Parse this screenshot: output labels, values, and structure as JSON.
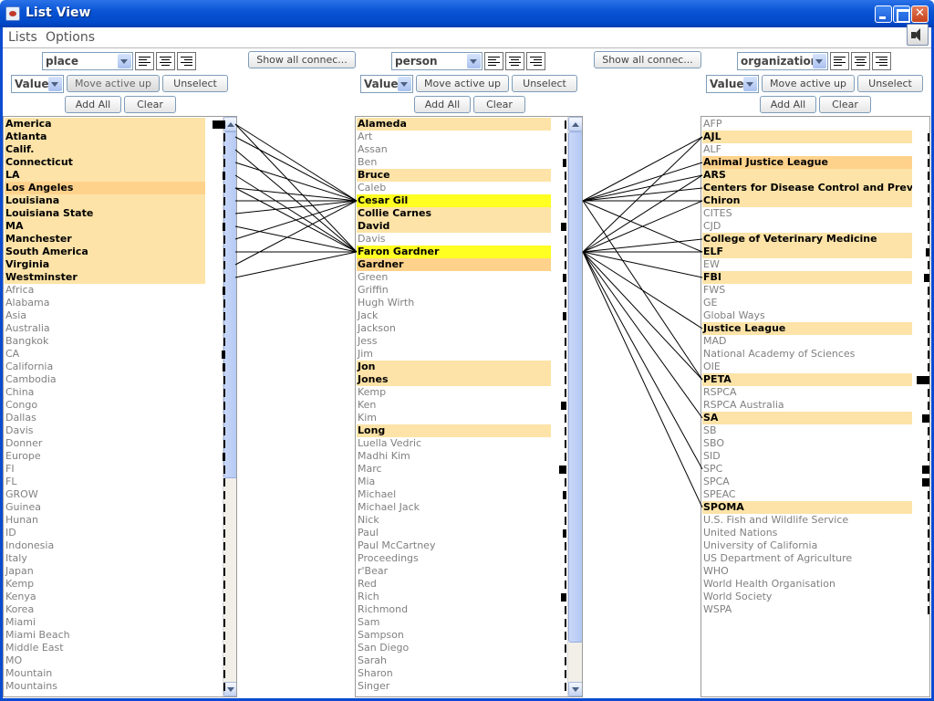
{
  "window": {
    "title": "List View"
  },
  "menu": {
    "lists": "Lists",
    "options": "Options"
  },
  "colors": {
    "selected": "#fde3a7",
    "selected_strong": "#ffd28c",
    "highlight": "#ffff22",
    "muted_text": "#808080",
    "line": "#000000"
  },
  "show_all_label": "Show all connec...",
  "panels": [
    {
      "type": "place",
      "sort_mode": "Value",
      "move_up_label": "Move active up",
      "unselect_label": "Unselect",
      "add_all_label": "Add All",
      "clear_label": "Clear",
      "items": [
        {
          "label": "America",
          "state": "selected",
          "count": 14
        },
        {
          "label": "Atlanta",
          "state": "selected",
          "count": 1
        },
        {
          "label": "Calif.",
          "state": "selected",
          "count": 1
        },
        {
          "label": "Connecticut",
          "state": "selected",
          "count": 1
        },
        {
          "label": "LA",
          "state": "selected",
          "count": 3
        },
        {
          "label": "Los Angeles",
          "state": "selected-strong",
          "count": 2
        },
        {
          "label": "Louisiana",
          "state": "selected",
          "count": 1
        },
        {
          "label": "Louisiana State",
          "state": "selected",
          "count": 1
        },
        {
          "label": "MA",
          "state": "selected",
          "count": 3
        },
        {
          "label": "Manchester",
          "state": "selected",
          "count": 1
        },
        {
          "label": "South America",
          "state": "selected",
          "count": 1
        },
        {
          "label": "Virginia",
          "state": "selected",
          "count": 2
        },
        {
          "label": "Westminster",
          "state": "selected",
          "count": 1
        },
        {
          "label": "Africa",
          "state": "none",
          "count": 3
        },
        {
          "label": "Alabama",
          "state": "none",
          "count": 1
        },
        {
          "label": "Asia",
          "state": "none",
          "count": 2
        },
        {
          "label": "Australia",
          "state": "none",
          "count": 2
        },
        {
          "label": "Bangkok",
          "state": "none",
          "count": 1
        },
        {
          "label": "CA",
          "state": "none",
          "count": 4
        },
        {
          "label": "California",
          "state": "none",
          "count": 3
        },
        {
          "label": "Cambodia",
          "state": "none",
          "count": 1
        },
        {
          "label": "China",
          "state": "none",
          "count": 1
        },
        {
          "label": "Congo",
          "state": "none",
          "count": 1
        },
        {
          "label": "Dallas",
          "state": "none",
          "count": 1
        },
        {
          "label": "Davis",
          "state": "none",
          "count": 1
        },
        {
          "label": "Donner",
          "state": "none",
          "count": 1
        },
        {
          "label": "Europe",
          "state": "none",
          "count": 3
        },
        {
          "label": "FI",
          "state": "none",
          "count": 1
        },
        {
          "label": "FL",
          "state": "none",
          "count": 1
        },
        {
          "label": "GROW",
          "state": "none",
          "count": 1
        },
        {
          "label": "Guinea",
          "state": "none",
          "count": 1
        },
        {
          "label": "Hunan",
          "state": "none",
          "count": 1
        },
        {
          "label": "ID",
          "state": "none",
          "count": 2
        },
        {
          "label": "Indonesia",
          "state": "none",
          "count": 1
        },
        {
          "label": "Italy",
          "state": "none",
          "count": 1
        },
        {
          "label": "Japan",
          "state": "none",
          "count": 2
        },
        {
          "label": "Kemp",
          "state": "none",
          "count": 1
        },
        {
          "label": "Kenya",
          "state": "none",
          "count": 1
        },
        {
          "label": "Korea",
          "state": "none",
          "count": 1
        },
        {
          "label": "Miami",
          "state": "none",
          "count": 1
        },
        {
          "label": "Miami Beach",
          "state": "none",
          "count": 1
        },
        {
          "label": "Middle East",
          "state": "none",
          "count": 1
        },
        {
          "label": "MO",
          "state": "none",
          "count": 1
        },
        {
          "label": "Mountain",
          "state": "none",
          "count": 2
        },
        {
          "label": "Mountains",
          "state": "none",
          "count": 1
        }
      ]
    },
    {
      "type": "person",
      "sort_mode": "Value",
      "move_up_label": "Move active up",
      "unselect_label": "Unselect",
      "add_all_label": "Add All",
      "clear_label": "Clear",
      "items": [
        {
          "label": "Alameda",
          "state": "selected",
          "count": 1
        },
        {
          "label": "Art",
          "state": "none",
          "count": 1
        },
        {
          "label": "Assan",
          "state": "none",
          "count": 1
        },
        {
          "label": "Ben",
          "state": "none",
          "count": 2
        },
        {
          "label": "Bruce",
          "state": "selected",
          "count": 1
        },
        {
          "label": "Caleb",
          "state": "none",
          "count": 1
        },
        {
          "label": "Cesar Gil",
          "state": "highlight",
          "count": 1
        },
        {
          "label": "Collie Carnes",
          "state": "selected",
          "count": 1
        },
        {
          "label": "David",
          "state": "selected",
          "count": 3
        },
        {
          "label": "Davis",
          "state": "none",
          "count": 1
        },
        {
          "label": "Faron Gardner",
          "state": "highlight",
          "count": 1
        },
        {
          "label": "Gardner",
          "state": "selected-strong",
          "count": 1
        },
        {
          "label": "Green",
          "state": "none",
          "count": 2
        },
        {
          "label": "Griffin",
          "state": "none",
          "count": 1
        },
        {
          "label": "Hugh Wirth",
          "state": "none",
          "count": 1
        },
        {
          "label": "Jack",
          "state": "none",
          "count": 2
        },
        {
          "label": "Jackson",
          "state": "none",
          "count": 1
        },
        {
          "label": "Jess",
          "state": "none",
          "count": 1
        },
        {
          "label": "Jim",
          "state": "none",
          "count": 1
        },
        {
          "label": "Jon",
          "state": "selected",
          "count": 1
        },
        {
          "label": "Jones",
          "state": "selected",
          "count": 1
        },
        {
          "label": "Kemp",
          "state": "none",
          "count": 1
        },
        {
          "label": "Ken",
          "state": "none",
          "count": 3
        },
        {
          "label": "Kim",
          "state": "none",
          "count": 1
        },
        {
          "label": "Long",
          "state": "selected",
          "count": 1
        },
        {
          "label": "Luella Vedric",
          "state": "none",
          "count": 1
        },
        {
          "label": "Madhi Kim",
          "state": "none",
          "count": 1
        },
        {
          "label": "Marc",
          "state": "none",
          "count": 4
        },
        {
          "label": "Mia",
          "state": "none",
          "count": 1
        },
        {
          "label": "Michael",
          "state": "none",
          "count": 2
        },
        {
          "label": "Michael Jack",
          "state": "none",
          "count": 1
        },
        {
          "label": "Nick",
          "state": "none",
          "count": 1
        },
        {
          "label": "Paul",
          "state": "none",
          "count": 2
        },
        {
          "label": "Paul McCartney",
          "state": "none",
          "count": 1
        },
        {
          "label": "Proceedings",
          "state": "none",
          "count": 1
        },
        {
          "label": "r'Bear",
          "state": "none",
          "count": 1
        },
        {
          "label": "Red",
          "state": "none",
          "count": 1
        },
        {
          "label": "Rich",
          "state": "none",
          "count": 3
        },
        {
          "label": "Richmond",
          "state": "none",
          "count": 1
        },
        {
          "label": "Sam",
          "state": "none",
          "count": 1
        },
        {
          "label": "Sampson",
          "state": "none",
          "count": 1
        },
        {
          "label": "San Diego",
          "state": "none",
          "count": 1
        },
        {
          "label": "Sarah",
          "state": "none",
          "count": 1
        },
        {
          "label": "Sharon",
          "state": "none",
          "count": 1
        },
        {
          "label": "Singer",
          "state": "none",
          "count": 1
        }
      ]
    },
    {
      "type": "organization",
      "sort_mode": "Value",
      "move_up_label": "Move active up",
      "unselect_label": "Unselect",
      "add_all_label": "Add All",
      "clear_label": "Clear",
      "items": [
        {
          "label": "AFP",
          "state": "none",
          "count": 0
        },
        {
          "label": "AJL",
          "state": "selected",
          "count": 1
        },
        {
          "label": "ALF",
          "state": "none",
          "count": 1
        },
        {
          "label": "Animal Justice League",
          "state": "selected-strong",
          "count": 1
        },
        {
          "label": "ARS",
          "state": "selected",
          "count": 1
        },
        {
          "label": "Centers for Disease Control and Preventi",
          "state": "selected",
          "count": 1
        },
        {
          "label": "Chiron",
          "state": "selected",
          "count": 1
        },
        {
          "label": "CITES",
          "state": "none",
          "count": 1
        },
        {
          "label": "CJD",
          "state": "none",
          "count": 1
        },
        {
          "label": "College of Veterinary Medicine",
          "state": "selected",
          "count": 1
        },
        {
          "label": "ELF",
          "state": "selected",
          "count": 2
        },
        {
          "label": "EW",
          "state": "none",
          "count": 1
        },
        {
          "label": "FBI",
          "state": "selected",
          "count": 3
        },
        {
          "label": "FWS",
          "state": "none",
          "count": 1
        },
        {
          "label": "GE",
          "state": "none",
          "count": 1
        },
        {
          "label": "Global Ways",
          "state": "none",
          "count": 1
        },
        {
          "label": "Justice League",
          "state": "selected",
          "count": 1
        },
        {
          "label": "MAD",
          "state": "none",
          "count": 1
        },
        {
          "label": "National Academy of Sciences",
          "state": "none",
          "count": 1
        },
        {
          "label": "OIE",
          "state": "none",
          "count": 1
        },
        {
          "label": "PETA",
          "state": "selected",
          "count": 7
        },
        {
          "label": "RSPCA",
          "state": "none",
          "count": 1
        },
        {
          "label": "RSPCA Australia",
          "state": "none",
          "count": 1
        },
        {
          "label": "SA",
          "state": "selected",
          "count": 4
        },
        {
          "label": "SB",
          "state": "none",
          "count": 1
        },
        {
          "label": "SBO",
          "state": "none",
          "count": 1
        },
        {
          "label": "SID",
          "state": "none",
          "count": 1
        },
        {
          "label": "SPC",
          "state": "none",
          "count": 4
        },
        {
          "label": "SPCA",
          "state": "none",
          "count": 4
        },
        {
          "label": "SPEAC",
          "state": "none",
          "count": 1
        },
        {
          "label": "SPOMA",
          "state": "selected",
          "count": 1
        },
        {
          "label": "U.S. Fish and Wildlife Service",
          "state": "none",
          "count": 1
        },
        {
          "label": "United Nations",
          "state": "none",
          "count": 1
        },
        {
          "label": "University of California",
          "state": "none",
          "count": 1
        },
        {
          "label": "US Department of Agriculture",
          "state": "none",
          "count": 1
        },
        {
          "label": "WHO",
          "state": "none",
          "count": 1
        },
        {
          "label": "World Health Organisation",
          "state": "none",
          "count": 1
        },
        {
          "label": "World Society",
          "state": "none",
          "count": 1
        },
        {
          "label": "WSPA",
          "state": "none",
          "count": 1
        }
      ]
    }
  ],
  "connections": [
    {
      "from": "place.America",
      "to": "person.Cesar Gil"
    },
    {
      "from": "place.America",
      "to": "person.Faron Gardner"
    },
    {
      "from": "place.Atlanta",
      "to": "person.Cesar Gil"
    },
    {
      "from": "place.Calif.",
      "to": "person.Faron Gardner"
    },
    {
      "from": "place.Connecticut",
      "to": "person.Cesar Gil"
    },
    {
      "from": "place.LA",
      "to": "person.Faron Gardner"
    },
    {
      "from": "place.Los Angeles",
      "to": "person.Cesar Gil"
    },
    {
      "from": "place.Los Angeles",
      "to": "person.Faron Gardner"
    },
    {
      "from": "place.Louisiana",
      "to": "person.Cesar Gil"
    },
    {
      "from": "place.Louisiana State",
      "to": "person.Cesar Gil"
    },
    {
      "from": "place.MA",
      "to": "person.Faron Gardner"
    },
    {
      "from": "place.Manchester",
      "to": "person.Cesar Gil"
    },
    {
      "from": "place.South America",
      "to": "person.Faron Gardner"
    },
    {
      "from": "place.Virginia",
      "to": "person.Cesar Gil"
    },
    {
      "from": "place.Westminster",
      "to": "person.Faron Gardner"
    },
    {
      "from": "person.Cesar Gil",
      "to": "organization.AJL"
    },
    {
      "from": "person.Cesar Gil",
      "to": "organization.Animal Justice League"
    },
    {
      "from": "person.Cesar Gil",
      "to": "organization.ARS"
    },
    {
      "from": "person.Cesar Gil",
      "to": "organization.Centers for Disease Control and Preventi"
    },
    {
      "from": "person.Cesar Gil",
      "to": "organization.Chiron"
    },
    {
      "from": "person.Cesar Gil",
      "to": "organization.ELF"
    },
    {
      "from": "person.Cesar Gil",
      "to": "organization.PETA"
    },
    {
      "from": "person.Faron Gardner",
      "to": "organization.AJL"
    },
    {
      "from": "person.Faron Gardner",
      "to": "organization.ARS"
    },
    {
      "from": "person.Faron Gardner",
      "to": "organization.Chiron"
    },
    {
      "from": "person.Faron Gardner",
      "to": "organization.College of Veterinary Medicine"
    },
    {
      "from": "person.Faron Gardner",
      "to": "organization.ELF"
    },
    {
      "from": "person.Faron Gardner",
      "to": "organization.FBI"
    },
    {
      "from": "person.Faron Gardner",
      "to": "organization.Justice League"
    },
    {
      "from": "person.Faron Gardner",
      "to": "organization.PETA"
    },
    {
      "from": "person.Faron Gardner",
      "to": "organization.SA"
    },
    {
      "from": "person.Faron Gardner",
      "to": "organization.SPC"
    },
    {
      "from": "person.Faron Gardner",
      "to": "organization.SPOMA"
    }
  ]
}
